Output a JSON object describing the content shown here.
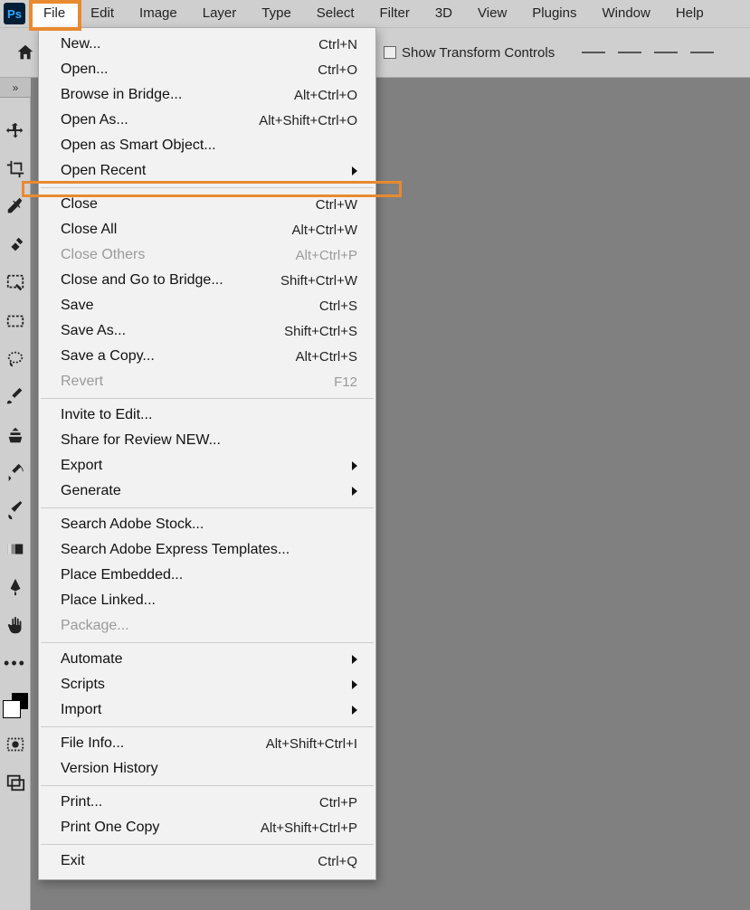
{
  "app_logo": "Ps",
  "menubar": [
    "File",
    "Edit",
    "Image",
    "Layer",
    "Type",
    "Select",
    "Filter",
    "3D",
    "View",
    "Plugins",
    "Window",
    "Help"
  ],
  "menubar_active_index": 0,
  "optionsbar": {
    "show_transform_label": "Show Transform Controls"
  },
  "dropdown": {
    "groups": [
      [
        {
          "label": "New...",
          "shortcut": "Ctrl+N",
          "disabled": false,
          "sub": false
        },
        {
          "label": "Open...",
          "shortcut": "Ctrl+O",
          "disabled": false,
          "sub": false
        },
        {
          "label": "Browse in Bridge...",
          "shortcut": "Alt+Ctrl+O",
          "disabled": false,
          "sub": false
        },
        {
          "label": "Open As...",
          "shortcut": "Alt+Shift+Ctrl+O",
          "disabled": false,
          "sub": false
        },
        {
          "label": "Open as Smart Object...",
          "shortcut": "",
          "disabled": false,
          "sub": false
        },
        {
          "label": "Open Recent",
          "shortcut": "",
          "disabled": false,
          "sub": true
        }
      ],
      [
        {
          "label": "Close",
          "shortcut": "Ctrl+W",
          "disabled": false,
          "sub": false
        },
        {
          "label": "Close All",
          "shortcut": "Alt+Ctrl+W",
          "disabled": false,
          "sub": false
        },
        {
          "label": "Close Others",
          "shortcut": "Alt+Ctrl+P",
          "disabled": true,
          "sub": false
        },
        {
          "label": "Close and Go to Bridge...",
          "shortcut": "Shift+Ctrl+W",
          "disabled": false,
          "sub": false
        },
        {
          "label": "Save",
          "shortcut": "Ctrl+S",
          "disabled": false,
          "sub": false
        },
        {
          "label": "Save As...",
          "shortcut": "Shift+Ctrl+S",
          "disabled": false,
          "sub": false
        },
        {
          "label": "Save a Copy...",
          "shortcut": "Alt+Ctrl+S",
          "disabled": false,
          "sub": false
        },
        {
          "label": "Revert",
          "shortcut": "F12",
          "disabled": true,
          "sub": false
        }
      ],
      [
        {
          "label": "Invite to Edit...",
          "shortcut": "",
          "disabled": false,
          "sub": false
        },
        {
          "label": "Share for Review NEW...",
          "shortcut": "",
          "disabled": false,
          "sub": false
        },
        {
          "label": "Export",
          "shortcut": "",
          "disabled": false,
          "sub": true
        },
        {
          "label": "Generate",
          "shortcut": "",
          "disabled": false,
          "sub": true
        }
      ],
      [
        {
          "label": "Search Adobe Stock...",
          "shortcut": "",
          "disabled": false,
          "sub": false
        },
        {
          "label": "Search Adobe Express Templates...",
          "shortcut": "",
          "disabled": false,
          "sub": false
        },
        {
          "label": "Place Embedded...",
          "shortcut": "",
          "disabled": false,
          "sub": false
        },
        {
          "label": "Place Linked...",
          "shortcut": "",
          "disabled": false,
          "sub": false
        },
        {
          "label": "Package...",
          "shortcut": "",
          "disabled": true,
          "sub": false
        }
      ],
      [
        {
          "label": "Automate",
          "shortcut": "",
          "disabled": false,
          "sub": true
        },
        {
          "label": "Scripts",
          "shortcut": "",
          "disabled": false,
          "sub": true
        },
        {
          "label": "Import",
          "shortcut": "",
          "disabled": false,
          "sub": true
        }
      ],
      [
        {
          "label": "File Info...",
          "shortcut": "Alt+Shift+Ctrl+I",
          "disabled": false,
          "sub": false
        },
        {
          "label": "Version History",
          "shortcut": "",
          "disabled": false,
          "sub": false
        }
      ],
      [
        {
          "label": "Print...",
          "shortcut": "Ctrl+P",
          "disabled": false,
          "sub": false
        },
        {
          "label": "Print One Copy",
          "shortcut": "Alt+Shift+Ctrl+P",
          "disabled": false,
          "sub": false
        }
      ],
      [
        {
          "label": "Exit",
          "shortcut": "Ctrl+Q",
          "disabled": false,
          "sub": false
        }
      ]
    ]
  },
  "tools": [
    "move-tool",
    "crop-tool",
    "eyedropper-tool",
    "spot-heal-tool",
    "object-select-tool",
    "marquee-tool",
    "lasso-tool",
    "brush-tool",
    "clone-stamp-tool",
    "history-brush-tool",
    "paint-brush-tool",
    "gradient-tool",
    "pen-tool",
    "hand-tool",
    "more-tools"
  ]
}
